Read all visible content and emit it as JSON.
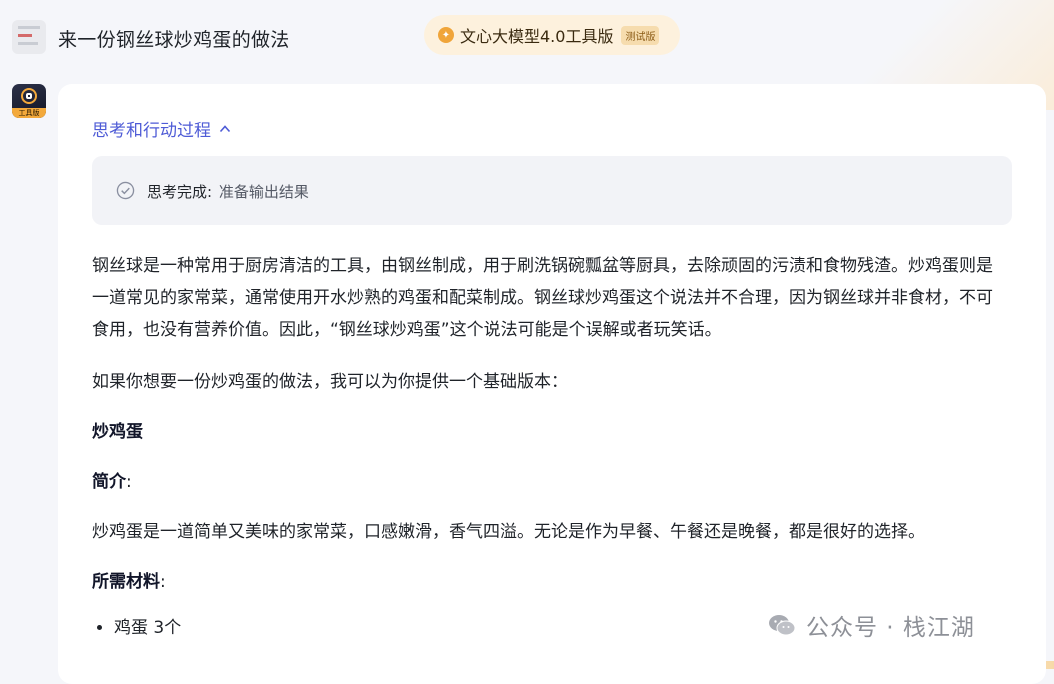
{
  "header": {
    "question": "来一份钢丝球炒鸡蛋的做法",
    "model_name": "文心大模型4.0工具版",
    "test_tag": "测试版"
  },
  "bot": {
    "avatar_tag": "工具版"
  },
  "process": {
    "toggle_label": "思考和行动过程",
    "done_label": "思考完成:",
    "status": "准备输出结果"
  },
  "content": {
    "para1": "钢丝球是一种常用于厨房清洁的工具，由钢丝制成，用于刷洗锅碗瓢盆等厨具，去除顽固的污渍和食物残渣。炒鸡蛋则是一道常见的家常菜，通常使用开水炒熟的鸡蛋和配菜制成。钢丝球炒鸡蛋这个说法并不合理，因为钢丝球并非食材，不可食用，也没有营养价值。因此，“钢丝球炒鸡蛋”这个说法可能是个误解或者玩笑话。",
    "para2": "如果你想要一份炒鸡蛋的做法，我可以为你提供一个基础版本：",
    "dish_title": "炒鸡蛋",
    "intro_heading": "简介",
    "intro_text": "炒鸡蛋是一道简单又美味的家常菜，口感嫩滑，香气四溢。无论是作为早餐、午餐还是晚餐，都是很好的选择。",
    "materials_heading": "所需材料",
    "colon": ":",
    "ingredients": [
      "鸡蛋 3个"
    ]
  },
  "watermark": {
    "text": "公众号 · 栈江湖"
  },
  "colors": {
    "accent": "#4e5bd6",
    "badge_bg": "#fdf1dd",
    "card_bg": "#ffffff",
    "page_bg": "#f5f6fa"
  }
}
